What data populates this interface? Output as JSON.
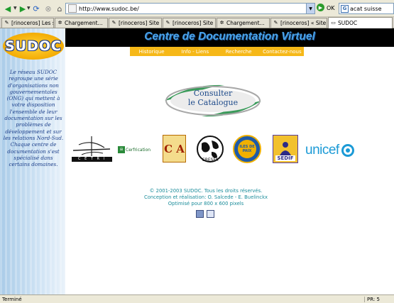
{
  "browser": {
    "address": "http://www.sudoc.be/",
    "go_label": "OK",
    "search_text": "acat suisse",
    "tabs": [
      {
        "label": "[rinoceros] Les si..."
      },
      {
        "label": "Chargement..."
      },
      {
        "label": "[rinoceros] Site r..."
      },
      {
        "label": "[rinoceros] Site r..."
      },
      {
        "label": "Chargement..."
      },
      {
        "label": "[rinoceros] « Site..."
      },
      {
        "label": "SUDOC"
      }
    ],
    "status": "Terminé",
    "status_right": "PR: 5"
  },
  "page": {
    "logo": "SUDOC",
    "banner_title": "Centre de Documentation Virtuel",
    "nav": [
      "Historique",
      "Info - Liens",
      "Recherche",
      "Contactez-nous"
    ],
    "sidebar_text": "Le réseau SUDOC regroupe une série d'organisations non gouvernementales (ONG) qui mettent à votre disposition l'ensemble de leur documentation sur les problèmes de développement et sur les relations Nord-Sud. Chaque centre de documentation s'est spécialisé dans certains domaines.",
    "catalogue_line1": "Consulter",
    "catalogue_line2": "le Catalogue",
    "partners": {
      "cetri": "C E T R I",
      "cerfi": "Cerfrication",
      "coa": "C A",
      "cresfa": "CRESFA",
      "iles": "ILES DE PAIX",
      "sedif": "SEDIF",
      "unicef": "unicef"
    },
    "footer_line1": "© 2001-2003 SUDOC. Tous les droits réservés.",
    "footer_line2": "Conception et réalisation: O. Salcede - E. Buelinckx",
    "footer_line3": "Optimisé pour 800 x 600 pixels"
  },
  "colors": {
    "banner_bg": "#000000",
    "banner_title": "#4aa3e8",
    "nav_bg": "#f6b818",
    "logo": "#f3a900",
    "footer_text": "#1a8c9a"
  }
}
